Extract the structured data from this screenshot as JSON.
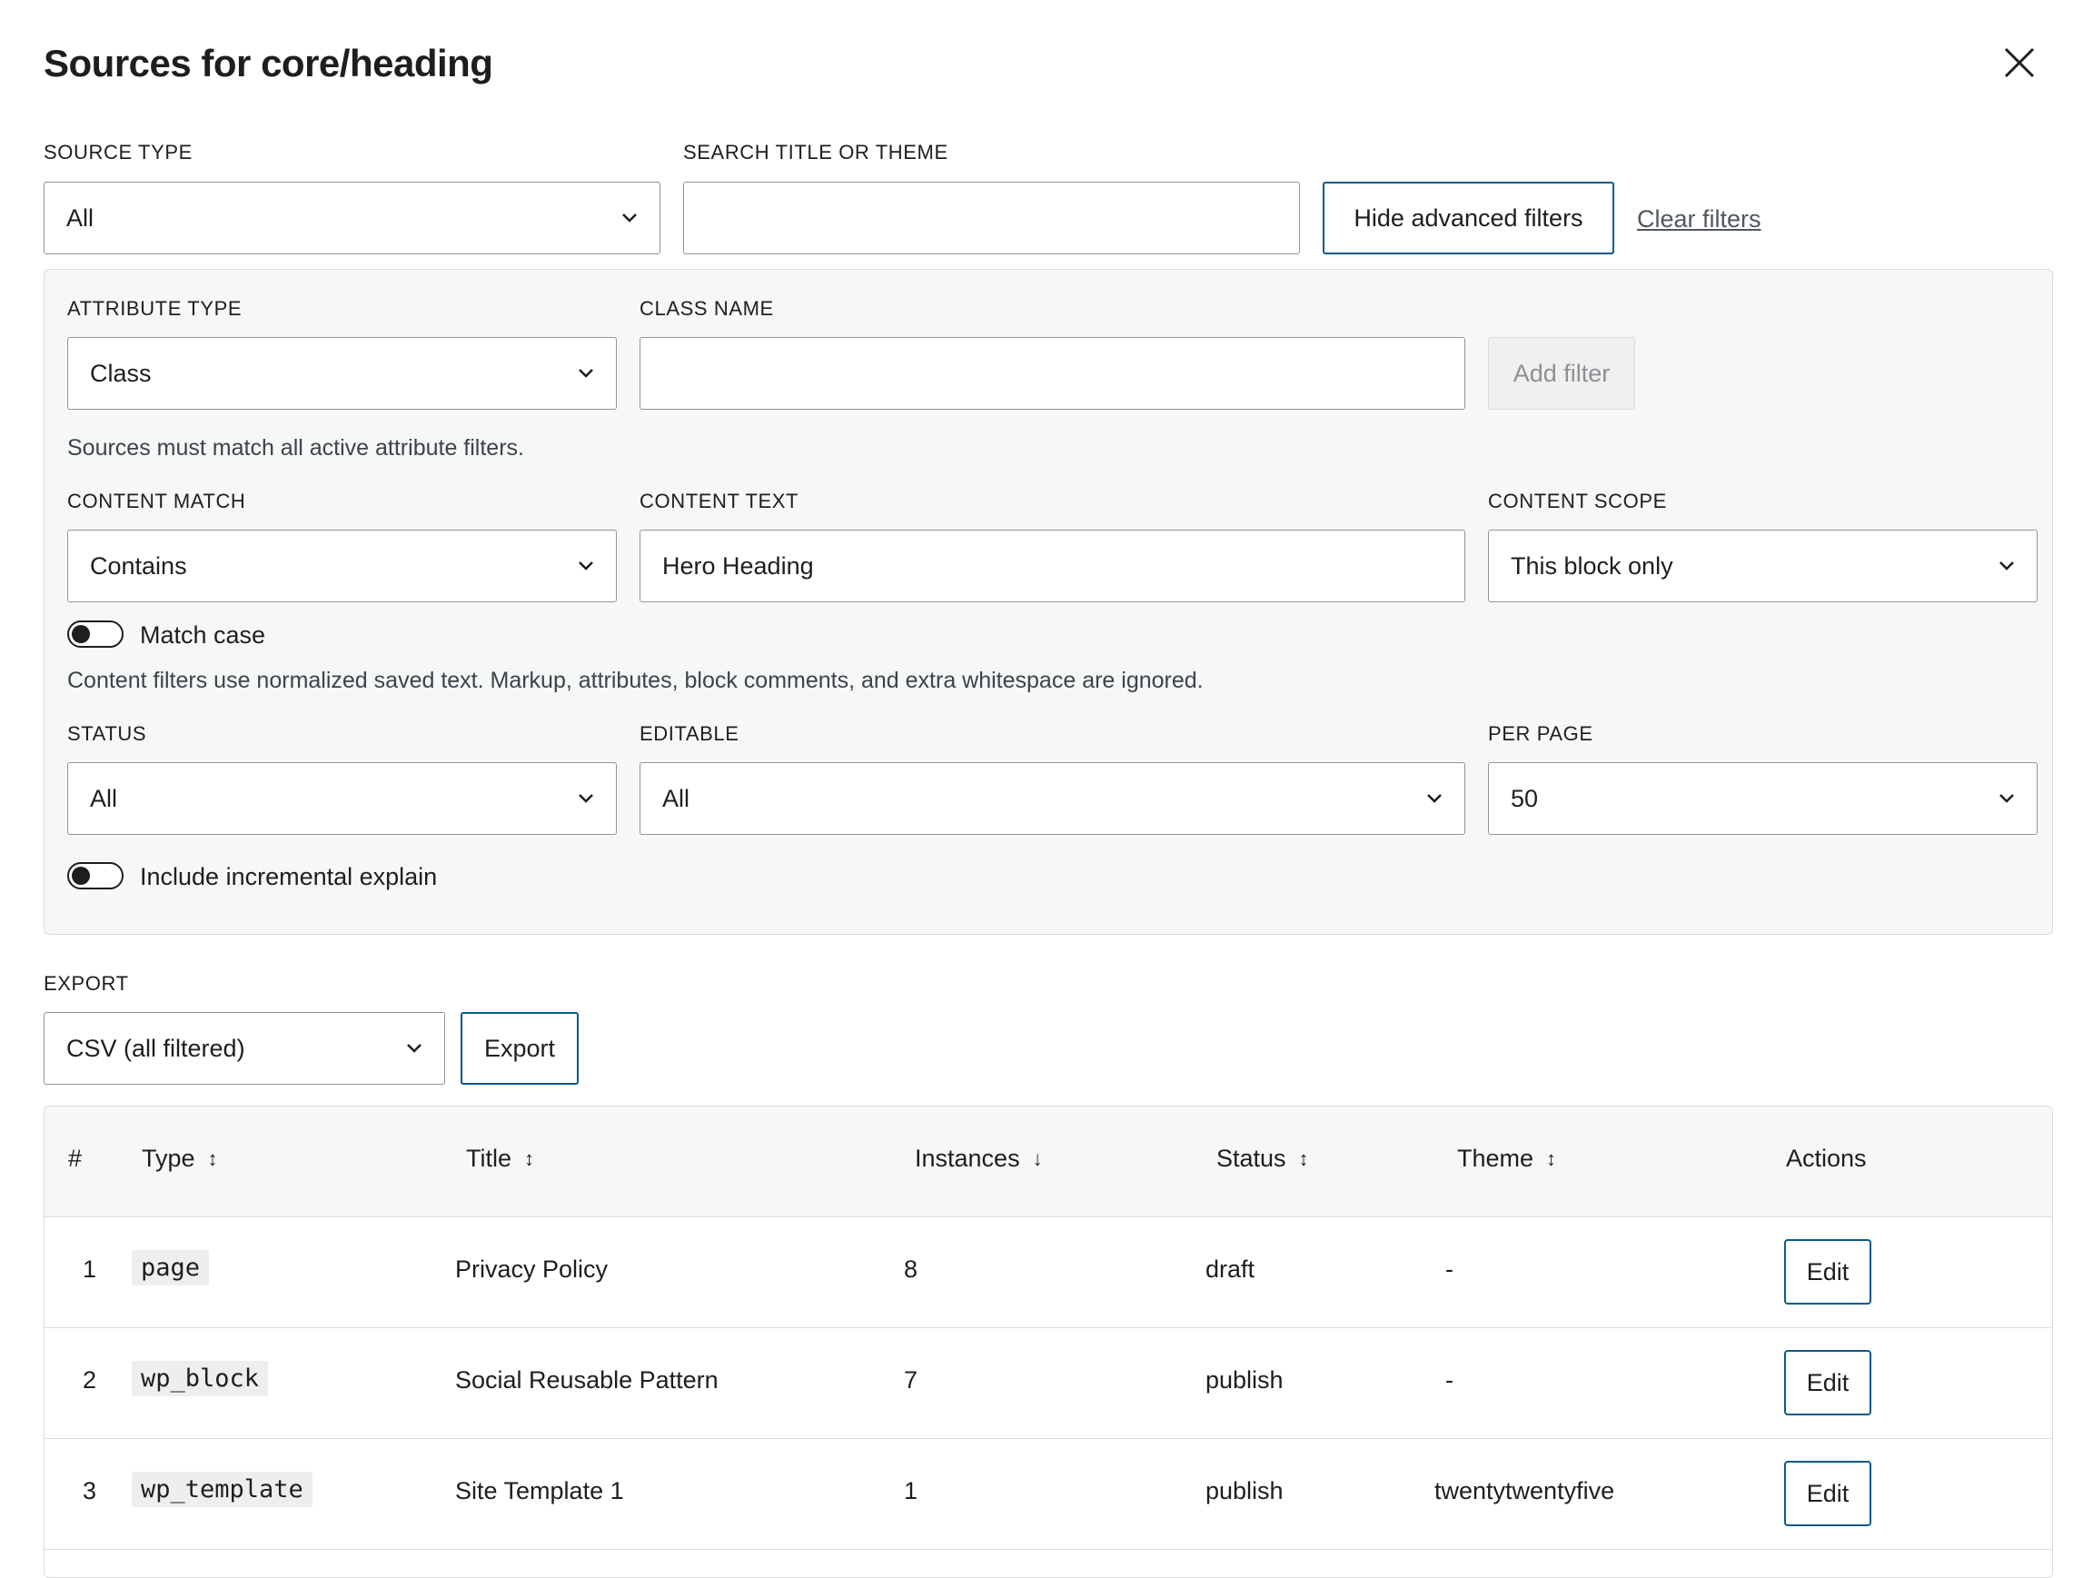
{
  "dialog": {
    "title": "Sources for core/heading",
    "close_icon": "close-icon"
  },
  "filters": {
    "source_type": {
      "label": "SOURCE TYPE",
      "value": "All"
    },
    "search": {
      "label": "SEARCH TITLE OR THEME",
      "value": "",
      "placeholder": ""
    },
    "hide_advanced_label": "Hide advanced filters",
    "clear_label": "Clear filters"
  },
  "advanced": {
    "attribute_type": {
      "label": "ATTRIBUTE TYPE",
      "value": "Class"
    },
    "class_name": {
      "label": "CLASS NAME",
      "value": ""
    },
    "add_filter_label": "Add filter",
    "attr_hint": "Sources must match all active attribute filters.",
    "content_match": {
      "label": "CONTENT MATCH",
      "value": "Contains"
    },
    "content_text": {
      "label": "CONTENT TEXT",
      "value": "Hero Heading"
    },
    "content_scope": {
      "label": "CONTENT SCOPE",
      "value": "This block only"
    },
    "match_case": {
      "label": "Match case",
      "checked": false
    },
    "content_hint": "Content filters use normalized saved text. Markup, attributes, block comments, and extra whitespace are ignored.",
    "status": {
      "label": "STATUS",
      "value": "All"
    },
    "editable": {
      "label": "EDITABLE",
      "value": "All"
    },
    "per_page": {
      "label": "PER PAGE",
      "value": "50"
    },
    "incremental": {
      "label": "Include incremental explain",
      "checked": false
    }
  },
  "export": {
    "label": "EXPORT",
    "format": "CSV (all filtered)",
    "button_label": "Export"
  },
  "table": {
    "columns": {
      "num": "#",
      "type": "Type",
      "title": "Title",
      "instances": "Instances",
      "status": "Status",
      "theme": "Theme",
      "actions": "Actions"
    },
    "rows": [
      {
        "num": "1",
        "type": "page",
        "title": "Privacy Policy",
        "instances": "8",
        "status": "draft",
        "theme": "-",
        "action": "Edit"
      },
      {
        "num": "2",
        "type": "wp_block",
        "title": "Social Reusable Pattern",
        "instances": "7",
        "status": "publish",
        "theme": "-",
        "action": "Edit"
      },
      {
        "num": "3",
        "type": "wp_template",
        "title": "Site Template 1",
        "instances": "1",
        "status": "publish",
        "theme": "twentytwentyfive",
        "action": "Edit"
      }
    ]
  },
  "colors": {
    "accent": "#0a5a8a",
    "panel_bg": "#f6f7f7",
    "border": "#949494"
  }
}
